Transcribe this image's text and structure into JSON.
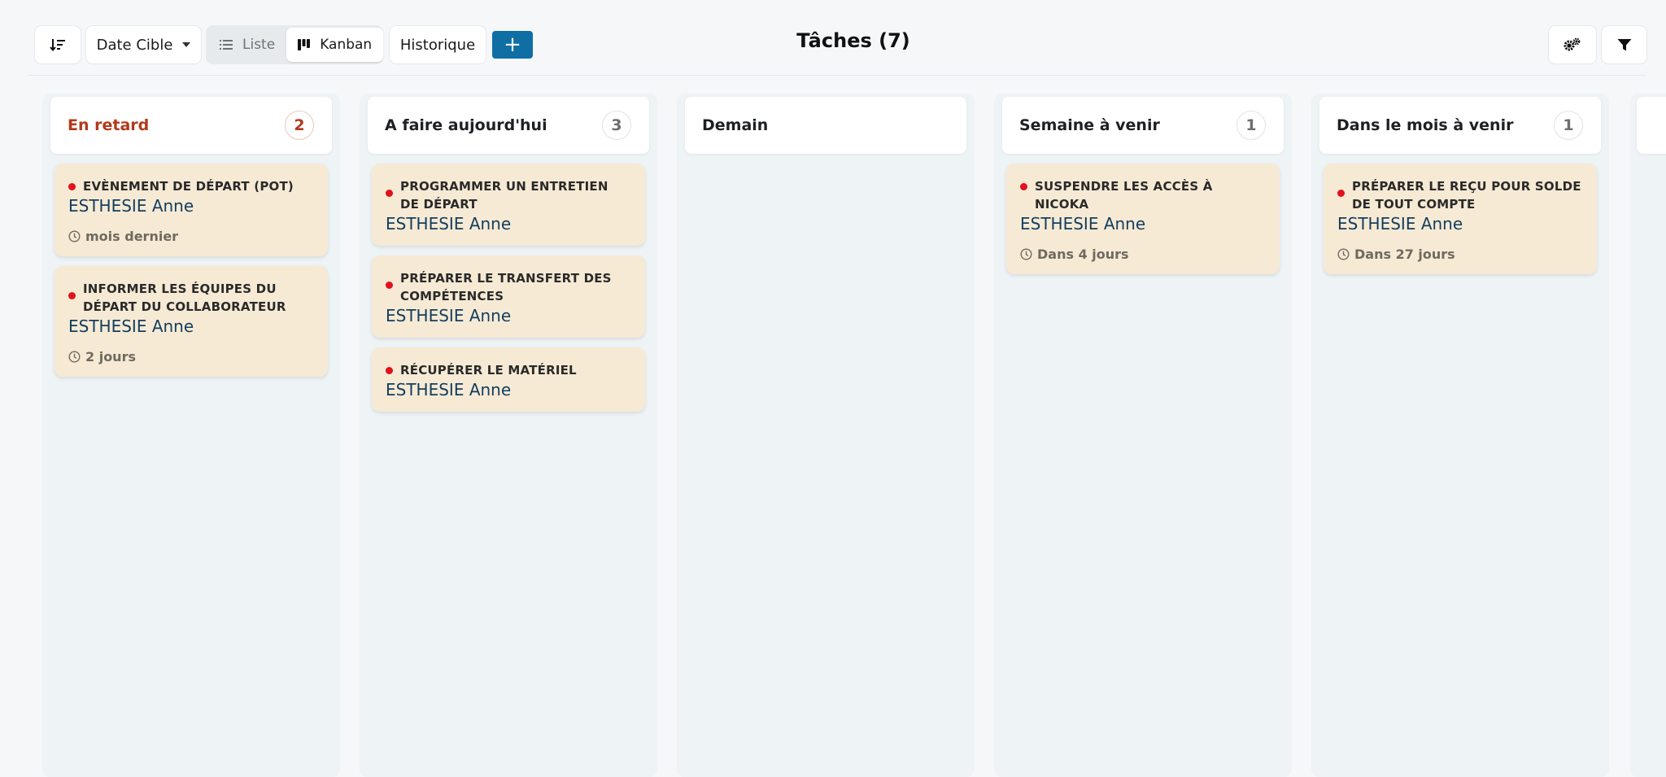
{
  "toolbar": {
    "sort_icon": "sort-descending-icon",
    "date_filter_label": "Date Cible",
    "view_list_label": "Liste",
    "view_kanban_label": "Kanban",
    "history_label": "Historique",
    "add_label": "+",
    "settings_icon": "gears-icon",
    "filter_icon": "funnel-icon"
  },
  "page": {
    "title": "Tâches (7)"
  },
  "colors": {
    "accent": "#0f6fa5",
    "late": "#b23a1a",
    "card_bg": "#f6ead5",
    "dot": "#e3101d",
    "person": "#133d5e"
  },
  "columns": [
    {
      "title": "En retard",
      "count": "2",
      "cards": [
        {
          "title": "EVÈNEMENT DE DÉPART (POT)",
          "person": "ESTHESIE Anne",
          "due": "mois dernier"
        },
        {
          "title": "INFORMER LES ÉQUIPES DU DÉPART DU COLLABORATEUR",
          "person": "ESTHESIE Anne",
          "due": "2 jours"
        }
      ]
    },
    {
      "title": "A faire aujourd'hui",
      "count": "3",
      "cards": [
        {
          "title": "PROGRAMMER UN ENTRETIEN DE DÉPART",
          "person": "ESTHESIE Anne"
        },
        {
          "title": "PRÉPARER LE TRANSFERT DES COMPÉTENCES",
          "person": "ESTHESIE Anne"
        },
        {
          "title": "RÉCUPÉRER LE MATÉRIEL",
          "person": "ESTHESIE Anne"
        }
      ]
    },
    {
      "title": "Demain",
      "count": "",
      "cards": []
    },
    {
      "title": "Semaine à venir",
      "count": "1",
      "cards": [
        {
          "title": "SUSPENDRE LES ACCÈS À NICOKA",
          "person": "ESTHESIE Anne",
          "due": "Dans 4 jours"
        }
      ]
    },
    {
      "title": "Dans le mois à venir",
      "count": "1",
      "cards": [
        {
          "title": "PRÉPARER LE REÇU POUR SOLDE DE TOUT COMPTE",
          "person": "ESTHESIE Anne",
          "due": "Dans 27 jours"
        }
      ]
    }
  ]
}
